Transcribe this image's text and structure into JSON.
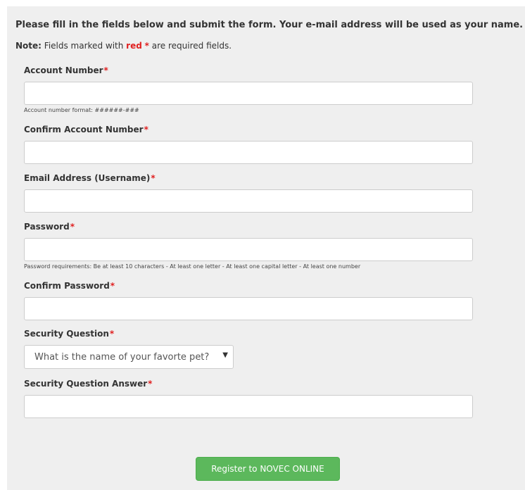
{
  "intro": "Please fill in the fields below and submit the form. Your e-mail address will be used as your name.",
  "note": {
    "prefix": "Note:",
    "text1": "Fields marked with",
    "red_word": "red",
    "asterisk": "*",
    "text2": "are required fields."
  },
  "fields": [
    {
      "label": "Account Number",
      "value": "",
      "help": "Account number format: ######-###"
    },
    {
      "label": "Confirm Account Number",
      "value": ""
    },
    {
      "label": "Email Address (Username)",
      "value": ""
    },
    {
      "label": "Password",
      "value": "",
      "help": "Password requirements: Be at least 10 characters - At least one letter - At least one capital letter - At least one number"
    },
    {
      "label": "Confirm Password",
      "value": ""
    },
    {
      "label": "Security Question",
      "selected": "What is the name of your favorte pet?"
    },
    {
      "label": "Security Question Answer",
      "value": ""
    }
  ],
  "required_marker": "*",
  "submit_label": "Register to NOVEC ONLINE",
  "colors": {
    "required": "#e02020",
    "button": "#5cb85c",
    "panel": "#efefef"
  }
}
